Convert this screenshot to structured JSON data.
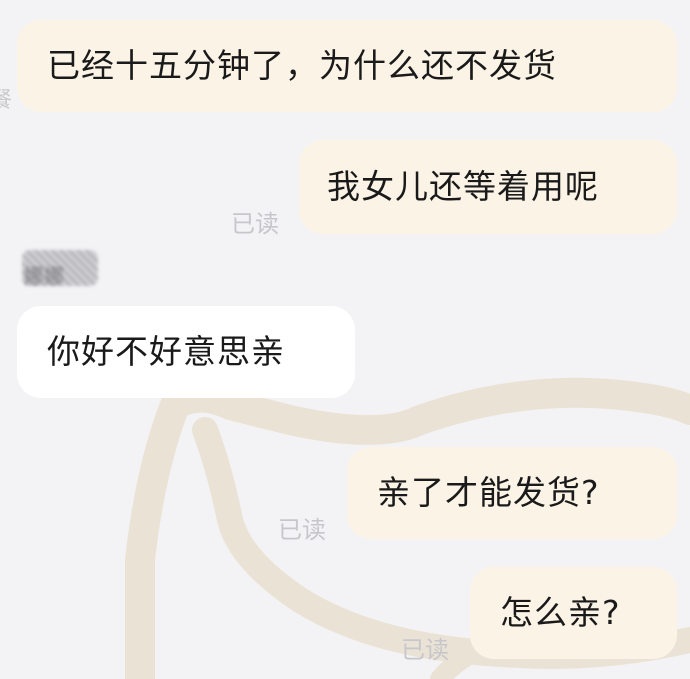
{
  "chat": {
    "messages": [
      {
        "sender": "me",
        "text": "已经十五分钟了，为什么还不发货"
      },
      {
        "sender": "me",
        "text": "我女儿还等着用呢",
        "status": "已读"
      },
      {
        "sender": "other",
        "name": "娜娜",
        "text": "你好不好意思亲"
      },
      {
        "sender": "me",
        "text": "亲了才能发货?",
        "status": "已读"
      },
      {
        "sender": "me",
        "text": "怎么亲?",
        "status": "已读"
      }
    ],
    "edge_fragment": "餐"
  },
  "colors": {
    "background": "#f3f3f5",
    "my_bubble": "#fbf3e6",
    "their_bubble": "#ffffff",
    "text": "#1a1a1a",
    "read_status": "#c7c7cb",
    "background_doodle": "#eae3d5"
  }
}
